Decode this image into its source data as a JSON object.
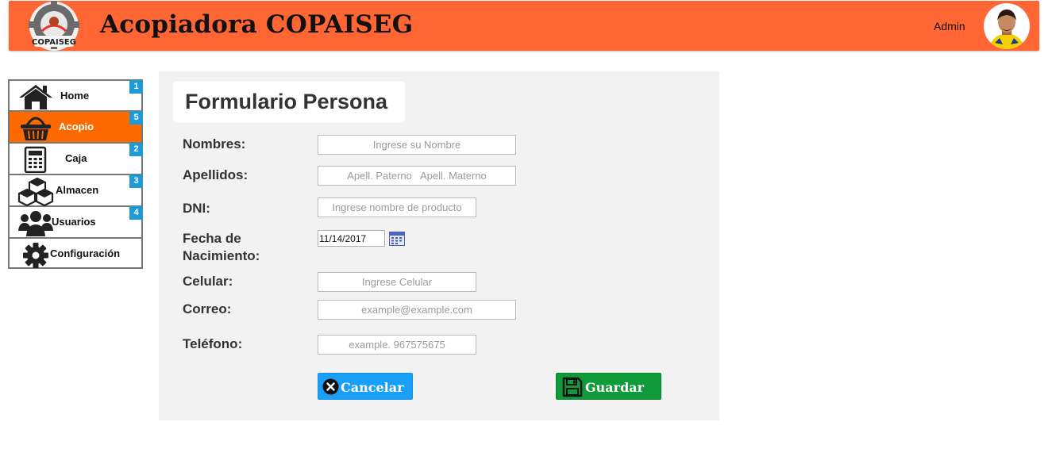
{
  "header": {
    "title": "Acopiadora COPAISEG",
    "logo_text": "COPAISEG",
    "user": "Admin",
    "background": "#ff6633"
  },
  "sidebar": {
    "items": [
      {
        "label": "Home",
        "badge": "1",
        "icon": "home-icon"
      },
      {
        "label": "Acopio",
        "badge": "5",
        "icon": "basket-icon",
        "active": true
      },
      {
        "label": "Caja",
        "badge": "2",
        "icon": "calculator-icon"
      },
      {
        "label": "Almacen",
        "badge": "3",
        "icon": "boxes-icon"
      },
      {
        "label": "Usuarios",
        "badge": "4",
        "icon": "users-icon"
      },
      {
        "label": "Configuración",
        "icon": "gear-icon"
      }
    ],
    "active_color": "#ff6a00",
    "badge_color": "#1e9bd7"
  },
  "form": {
    "title": "Formulario Persona",
    "fields": {
      "nombres": {
        "label": "Nombres:",
        "placeholder": "Ingrese su Nombre"
      },
      "apellidos": {
        "label": "Apellidos:",
        "placeholder": "Apell. Paterno   Apell. Materno"
      },
      "dni": {
        "label": "DNI:",
        "placeholder": "Ingrese nombre de producto"
      },
      "fecha": {
        "label_line1": "Fecha de",
        "label_line2": "Nacimiento:",
        "value": "11/14/2017"
      },
      "celular": {
        "label": "Celular:",
        "placeholder": "Ingrese Celular"
      },
      "correo": {
        "label": "Correo:",
        "placeholder": "example@example.com"
      },
      "telefono": {
        "label": "Teléfono:",
        "placeholder": "example. 967575675"
      }
    },
    "buttons": {
      "cancel": "Cancelar",
      "save": "Guardar"
    },
    "cancel_color": "#1b9ef5",
    "save_color": "#109a3a"
  }
}
